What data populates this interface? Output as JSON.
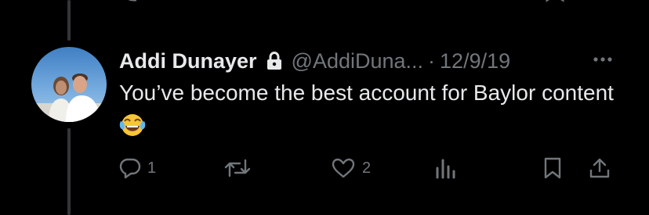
{
  "tweet": {
    "display_name": "Addi Dunayer",
    "handle": "@AddiDuna...",
    "separator": "·",
    "timestamp": "12/9/19",
    "text": "You’ve become the best account for Baylor content",
    "emoji": "face-with-tears-of-joy",
    "protected_account": true
  },
  "actions": {
    "reply_count": "1",
    "retweet_count": "",
    "like_count": "2"
  },
  "colors": {
    "background": "#000000",
    "primary_text": "#e7e9ea",
    "secondary_text": "#71767b",
    "thread_line": "#333639"
  }
}
